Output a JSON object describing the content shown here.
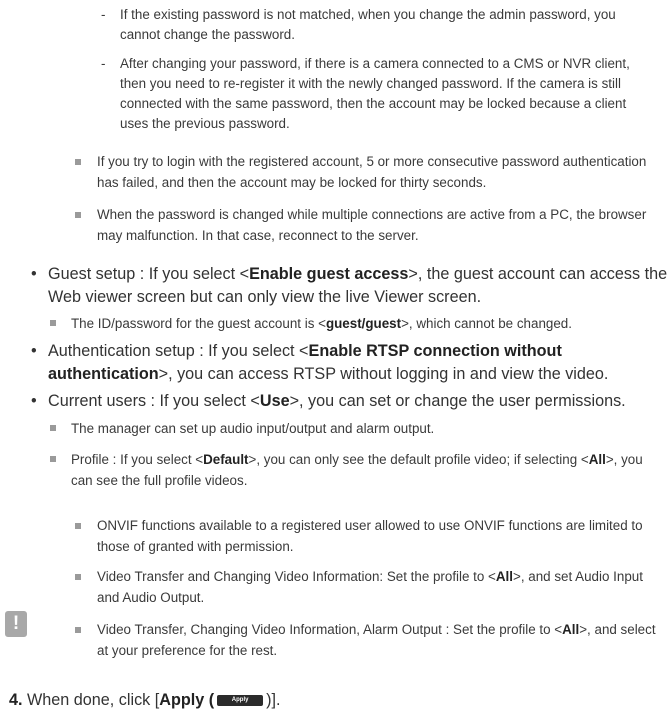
{
  "dash_items": [
    "If the existing password is not matched, when you change the admin password, you cannot change the password.",
    "After changing your password, if there is a camera connected to a CMS or NVR client, then you need to re-register it with the newly changed password. If the camera is still connected with the same password, then the account may be locked because a client uses the previous password."
  ],
  "square_items": [
    "If you try to login with the registered account, 5 or more consecutive password authentication has failed, and then the account may be locked for thirty seconds.",
    "When the password is changed while multiple connections are active from a PC, the browser may malfunction. In that case, reconnect to the server."
  ],
  "guest": {
    "pre": "Guest setup : If you select <",
    "bold": "Enable guest access",
    "post": ">, the guest account can access the Web viewer screen but can only view the live Viewer screen.",
    "sub_pre": "The ID/password for the guest account is <",
    "sub_bold": "guest/guest",
    "sub_post": ">, which cannot be changed."
  },
  "auth": {
    "pre": "Authentication setup : If you select <",
    "bold": "Enable RTSP connection without authentication",
    "post": ">, you can access RTSP without logging in and view the video."
  },
  "users": {
    "pre": "Current users : If you select <",
    "bold": "Use",
    "post": ">, you can set or change the user permissions.",
    "sub1": "The manager can set up audio input/output and alarm output.",
    "sub2_pre": "Profile : If you select <",
    "sub2_bold1": "Default",
    "sub2_mid": ">, you can only see the default profile video; if selecting <",
    "sub2_bold2": "All",
    "sub2_post": ">, you can see the full profile videos."
  },
  "note": {
    "icon": "!",
    "item1": "ONVIF functions available to a registered user allowed to use ONVIF functions are limited to those of granted with permission.",
    "item2_pre": "Video Transfer and Changing Video Information: Set the profile to <",
    "item2_bold": "All",
    "item2_post": ">, and set Audio Input and Audio Output.",
    "item3_pre": "Video Transfer, Changing Video Information, Alarm Output : Set the profile to <",
    "item3_bold": "All",
    "item3_post": ">, and select at your preference for the rest."
  },
  "step": {
    "number": "4.",
    "pre": "When done, click [",
    "bold": "Apply (",
    "button": "Apply",
    "post": ")]."
  }
}
